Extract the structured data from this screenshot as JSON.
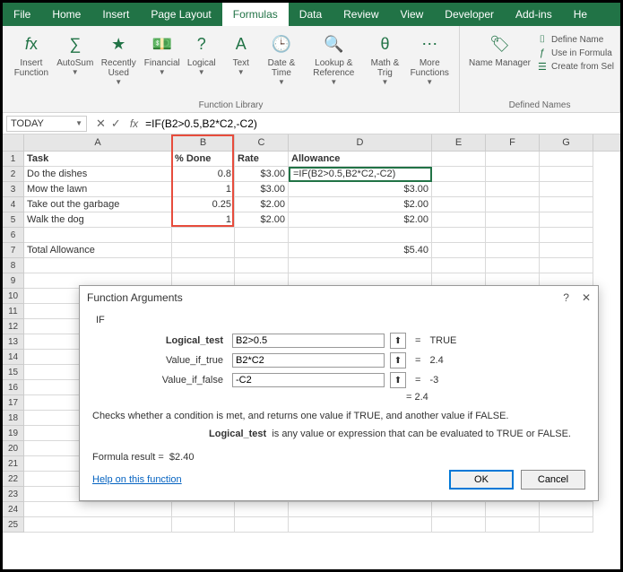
{
  "tabs": [
    "File",
    "Home",
    "Insert",
    "Page Layout",
    "Formulas",
    "Data",
    "Review",
    "View",
    "Developer",
    "Add-ins",
    "He"
  ],
  "active_tab": "Formulas",
  "ribbon": {
    "group1_label": "Function Library",
    "group2_label": "Defined Names",
    "insert_fn": "Insert\nFunction",
    "autosum": "AutoSum",
    "recent": "Recently\nUsed",
    "financial": "Financial",
    "logical": "Logical",
    "text": "Text",
    "date": "Date &\nTime",
    "lookup": "Lookup &\nReference",
    "math": "Math &\nTrig",
    "more": "More\nFunctions",
    "name_mgr": "Name\nManager",
    "def_name": "Define Name",
    "use_formula": "Use in Formula",
    "create_sel": "Create from Sel"
  },
  "namebox": "TODAY",
  "formula": "=IF(B2>0.5,B2*C2,-C2)",
  "columns": [
    "A",
    "B",
    "C",
    "D",
    "E",
    "F",
    "G"
  ],
  "rows": [
    {
      "n": "1",
      "A": "Task",
      "B": "% Done",
      "C": "Rate",
      "D": "Allowance",
      "bold": true
    },
    {
      "n": "2",
      "A": "Do the dishes",
      "B": "0.8",
      "C": "$3.00",
      "D": "=IF(B2>0.5,B2*C2,-C2)",
      "active": true
    },
    {
      "n": "3",
      "A": "Mow the lawn",
      "B": "1",
      "C": "$3.00",
      "D": "$3.00"
    },
    {
      "n": "4",
      "A": "Take out the garbage",
      "B": "0.25",
      "C": "$2.00",
      "D": "$2.00"
    },
    {
      "n": "5",
      "A": "Walk the dog",
      "B": "1",
      "C": "$2.00",
      "D": "$2.00"
    },
    {
      "n": "6"
    },
    {
      "n": "7",
      "A": "Total Allowance",
      "D": "$5.40"
    },
    {
      "n": "8"
    },
    {
      "n": "9"
    },
    {
      "n": "10"
    },
    {
      "n": "11"
    },
    {
      "n": "12"
    },
    {
      "n": "13"
    },
    {
      "n": "14"
    },
    {
      "n": "15"
    },
    {
      "n": "16"
    },
    {
      "n": "17"
    },
    {
      "n": "18"
    },
    {
      "n": "19"
    },
    {
      "n": "20"
    },
    {
      "n": "21"
    },
    {
      "n": "22"
    },
    {
      "n": "23"
    },
    {
      "n": "24"
    },
    {
      "n": "25"
    }
  ],
  "dialog": {
    "title": "Function Arguments",
    "fn": "IF",
    "args": [
      {
        "label": "Logical_test",
        "value": "B2>0.5",
        "result": "TRUE",
        "bold": true
      },
      {
        "label": "Value_if_true",
        "value": "B2*C2",
        "result": "2.4"
      },
      {
        "label": "Value_if_false",
        "value": "-C2",
        "result": "-3"
      }
    ],
    "eval": "= 2.4",
    "desc": "Checks whether a condition is met, and returns one value if TRUE, and another value if FALSE.",
    "desc2_label": "Logical_test",
    "desc2_text": "is any value or expression that can be evaluated to TRUE or FALSE.",
    "result_label": "Formula result =",
    "result_value": "$2.40",
    "help": "Help on this function",
    "ok": "OK",
    "cancel": "Cancel"
  }
}
